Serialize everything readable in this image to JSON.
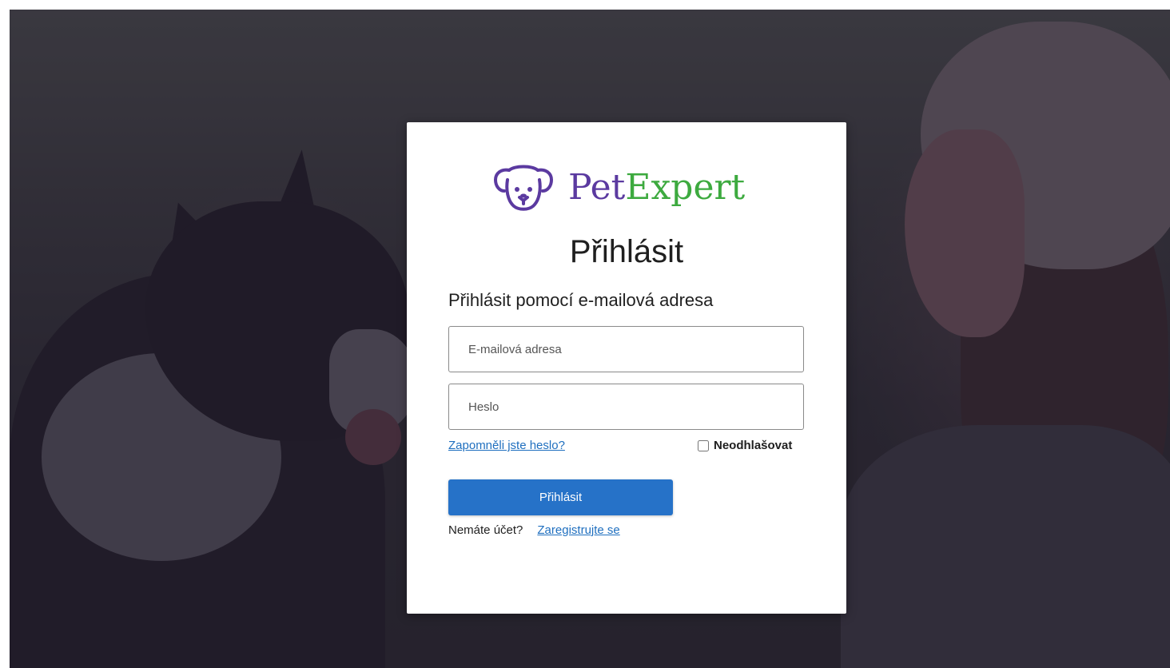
{
  "brand": {
    "name_part1": "Pet",
    "name_part2": "Expert",
    "color_primary": "#5b3aa0",
    "color_secondary": "#3daa3f"
  },
  "login": {
    "title": "Přihlásit",
    "subtitle": "Přihlásit pomocí e-mailová adresa",
    "email_placeholder": "E-mailová adresa",
    "password_placeholder": "Heslo",
    "forgot_link": "Zapomněli jste heslo?",
    "keep_signed_in": "Neodhlašovat",
    "submit_label": "Přihlásit",
    "no_account_text": "Nemáte účet?",
    "register_link": "Zaregistrujte se"
  },
  "icons": {
    "logo": "dog-face-icon"
  },
  "colors": {
    "button": "#2672c8",
    "link": "#1f6fbf"
  }
}
